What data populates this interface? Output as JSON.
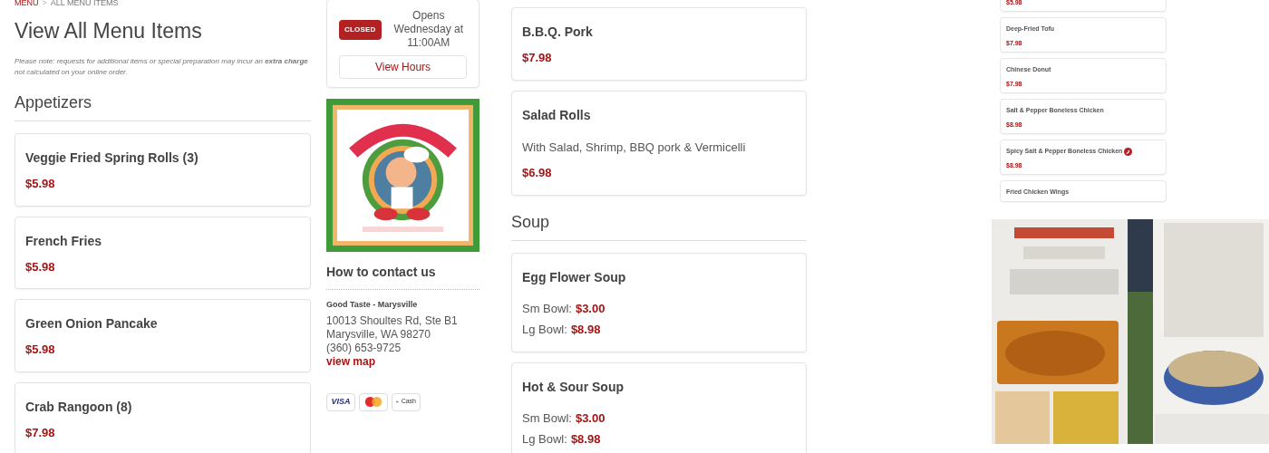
{
  "breadcrumb": {
    "link": "MENU",
    "separator": ">",
    "current": "ALL MENU ITEMS"
  },
  "page_title": "View All Menu Items",
  "note": "Please note: requests for additional items or special preparation may incur an **extra charge** not calculated on your online order.",
  "appetizers": {
    "heading": "Appetizers",
    "items": [
      {
        "kind": "simple",
        "name": "Veggie Fried Spring Rolls (3)",
        "price": "$5.98"
      },
      {
        "kind": "simple",
        "name": "French Fries",
        "price": "$5.98"
      },
      {
        "kind": "simple",
        "name": "Green Onion Pancake",
        "price": "$5.98"
      },
      {
        "kind": "simple",
        "name": "Crab Rangoon (8)",
        "price": "$7.98"
      }
    ]
  },
  "status": {
    "badge": "CLOSED",
    "open": false,
    "opens": "Opens Wednesday at 11:00AM",
    "button": "View Hours"
  },
  "contact": {
    "heading": "How to contact us",
    "name": "Good Taste - Marysville",
    "address_1": "10013 Shoultes Rd, Ste B1",
    "address_2": "Marysville, WA 98270",
    "phone": "(360) 653-9725",
    "map_link": "view map"
  },
  "payments": [
    {
      "kind": "visa",
      "label": "VISA"
    },
    {
      "kind": "mastercard"
    },
    {
      "kind": "cash",
      "label": "Cash"
    }
  ],
  "middle_items": [
    {
      "kind": "simple",
      "name": "B.B.Q. Pork",
      "price": "$7.98"
    },
    {
      "kind": "description",
      "name": "Salad Rolls",
      "description": "With Salad, Shrimp, BBQ pork & Vermicelli",
      "price": "$6.98"
    }
  ],
  "soup": {
    "heading": "Soup",
    "items": [
      {
        "kind": "sizes",
        "name": "Egg Flower Soup",
        "sizes": [
          {
            "label": "Sm Bowl:",
            "price": "$3.00"
          },
          {
            "label": "Lg Bowl:",
            "price": "$8.98"
          }
        ]
      },
      {
        "kind": "sizes",
        "name": "Hot & Sour Soup",
        "sizes": [
          {
            "label": "Sm Bowl:",
            "price": "$3.00"
          },
          {
            "label": "Lg Bowl:",
            "price": "$8.98"
          }
        ]
      }
    ]
  },
  "mini_menu": [
    {
      "price": "$5.98",
      "spicy": false
    },
    {
      "name": "Deep-Fried Tofu",
      "price": "$7.98",
      "spicy": false
    },
    {
      "name": "Chinese Donut",
      "price": "$7.98",
      "spicy": false
    },
    {
      "name": "Salt & Pepper Boneless Chicken",
      "price": "$8.98",
      "spicy": false
    },
    {
      "name": "Spicy Salt & Pepper Boneless Chicken",
      "price": "$8.98",
      "spicy": true
    },
    {
      "name": "Fried Chicken Wings",
      "spicy": false
    }
  ]
}
